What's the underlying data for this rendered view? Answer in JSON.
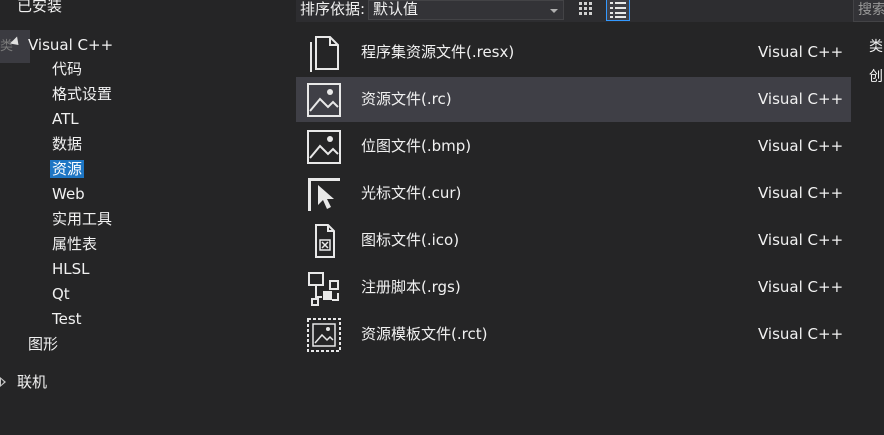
{
  "tree": {
    "installed": "已安装",
    "collapsed_tab": "类",
    "root": "Visual C++",
    "items": [
      "代码",
      "格式设置",
      "ATL",
      "数据",
      "资源",
      "Web",
      "实用工具",
      "属性表",
      "HLSL",
      "Qt",
      "Test"
    ],
    "selected_item": "资源",
    "graphics": "图形",
    "online": "联机"
  },
  "toolbar": {
    "sort_label": "排序依据:",
    "sort_value": "默认值"
  },
  "templates": [
    {
      "name": "程序集资源文件(.resx)",
      "lang": "Visual C++",
      "icon": "document-icon"
    },
    {
      "name": "资源文件(.rc)",
      "lang": "Visual C++",
      "icon": "image-icon"
    },
    {
      "name": "位图文件(.bmp)",
      "lang": "Visual C++",
      "icon": "bitmap-icon"
    },
    {
      "name": "光标文件(.cur)",
      "lang": "Visual C++",
      "icon": "cursor-icon"
    },
    {
      "name": "图标文件(.ico)",
      "lang": "Visual C++",
      "icon": "icon-file-icon"
    },
    {
      "name": "注册脚本(.rgs)",
      "lang": "Visual C++",
      "icon": "registry-script-icon"
    },
    {
      "name": "资源模板文件(.rct)",
      "lang": "Visual C++",
      "icon": "resource-template-icon"
    }
  ],
  "selected_template": "资源文件(.rc)",
  "right_panel": {
    "search_placeholder": "搜索",
    "type_label": "类",
    "create_label": "创"
  },
  "colors": {
    "background": "#252526",
    "selected_row": "#3f3f46",
    "selected_tree": "#1e76c4",
    "accent_border": "#3399ff"
  }
}
